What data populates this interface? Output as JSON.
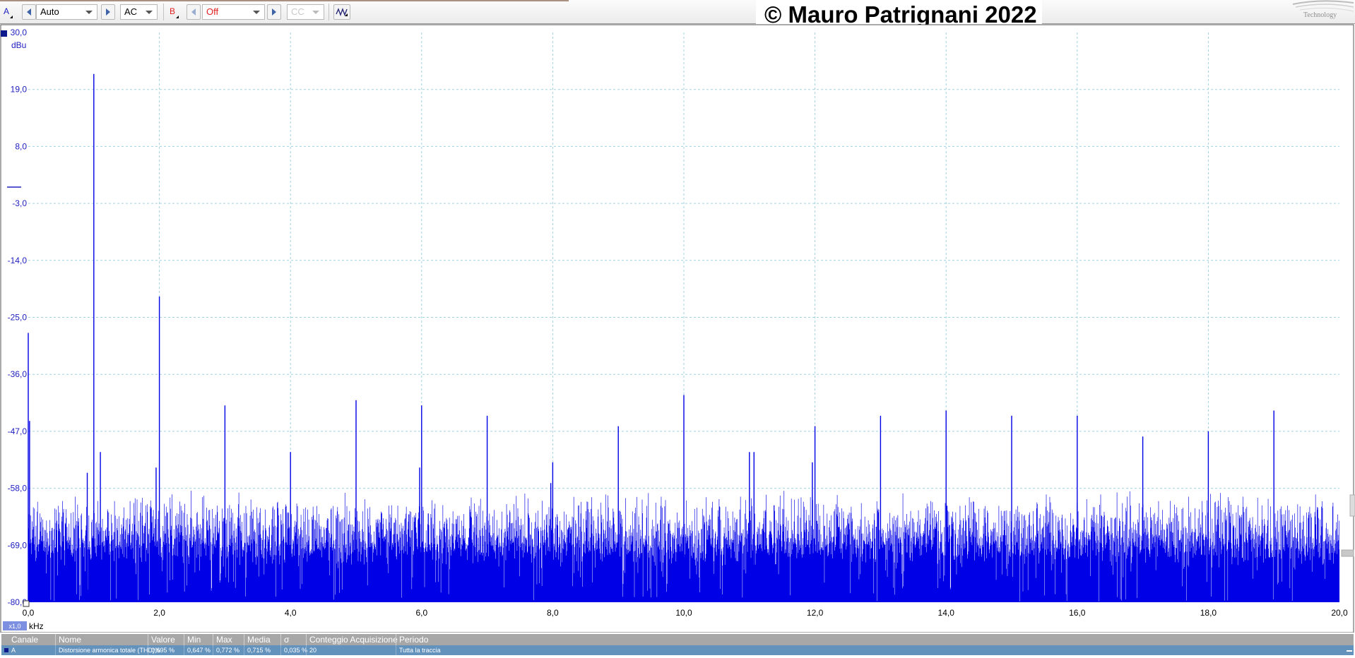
{
  "toolbar": {
    "channel_a": {
      "label": "A",
      "range_value": "Auto",
      "coupling_value": "AC",
      "color": "#2020c0"
    },
    "channel_b": {
      "label": "B",
      "range_value": "Off",
      "coupling_value": "CC",
      "color": "#e02020"
    },
    "options_icon": "wave-options-icon"
  },
  "watermark": "© Mauro Patrignani 2022",
  "logo_text": "Technology",
  "scale_badge": "x1,0",
  "chart_data": {
    "type": "line",
    "title": "",
    "xlabel": "kHz",
    "ylabel": "dBu",
    "x_ticks": [
      "0,0",
      "2,0",
      "4,0",
      "6,0",
      "8,0",
      "10,0",
      "12,0",
      "14,0",
      "16,0",
      "18,0",
      "20,0"
    ],
    "y_ticks": [
      "30,0",
      "19,0",
      "8,0",
      "-3,0",
      "-14,0",
      "-25,0",
      "-36,0",
      "-47,0",
      "-58,0",
      "-69,0",
      "-80,0"
    ],
    "xlim": [
      0,
      20
    ],
    "ylim": [
      -80,
      30
    ],
    "grid": true,
    "series": [
      {
        "color": "#0000e6",
        "noise_floor_range": [
          -80,
          -60
        ],
        "peaks": [
          {
            "x": 0.0,
            "y": -28
          },
          {
            "x": 0.02,
            "y": -45
          },
          {
            "x": 1.0,
            "y": 22
          },
          {
            "x": 0.9,
            "y": -55
          },
          {
            "x": 1.1,
            "y": -51
          },
          {
            "x": 2.0,
            "y": -21
          },
          {
            "x": 1.95,
            "y": -54
          },
          {
            "x": 3.0,
            "y": -42
          },
          {
            "x": 4.0,
            "y": -51
          },
          {
            "x": 5.0,
            "y": -41
          },
          {
            "x": 6.0,
            "y": -42
          },
          {
            "x": 5.97,
            "y": -54
          },
          {
            "x": 7.0,
            "y": -44
          },
          {
            "x": 8.0,
            "y": -53
          },
          {
            "x": 7.97,
            "y": -57
          },
          {
            "x": 9.0,
            "y": -46
          },
          {
            "x": 10.0,
            "y": -40
          },
          {
            "x": 11.0,
            "y": -51
          },
          {
            "x": 11.07,
            "y": -51
          },
          {
            "x": 12.0,
            "y": -46
          },
          {
            "x": 11.96,
            "y": -53
          },
          {
            "x": 13.0,
            "y": -44
          },
          {
            "x": 14.0,
            "y": -43
          },
          {
            "x": 15.0,
            "y": -44
          },
          {
            "x": 16.0,
            "y": -44
          },
          {
            "x": 17.0,
            "y": -48
          },
          {
            "x": 18.0,
            "y": -47
          },
          {
            "x": 19.0,
            "y": -43
          }
        ]
      }
    ]
  },
  "measurements": {
    "headers": [
      "Canale",
      "Nome",
      "Valore",
      "Min",
      "Max",
      "Media",
      "σ",
      "Conteggio Acquisizione",
      "Periodo"
    ],
    "rows": [
      [
        "A",
        "Distorsione armonica totale (THD)%",
        "0,695 %",
        "0,647 %",
        "0,772 %",
        "0,715 %",
        "0,035 %",
        "20",
        "Tutta la traccia"
      ]
    ]
  }
}
